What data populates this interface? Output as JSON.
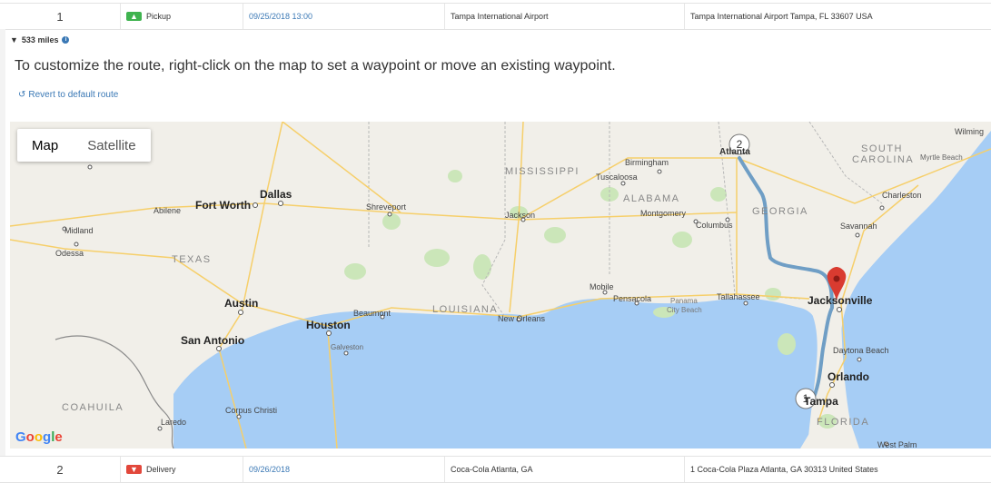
{
  "stop1": {
    "number": "1",
    "type": "Pickup",
    "date": "09/25/2018 13:00",
    "location": "Tampa International Airport",
    "address": "Tampa International Airport Tampa, FL 33607 USA"
  },
  "route": {
    "distance": "533 miles",
    "instructions": "To customize the route, right-click on the map to set a waypoint or move an existing waypoint.",
    "revert_label": "Revert to default route"
  },
  "map": {
    "type_map": "Map",
    "type_satellite": "Satellite",
    "logo": "Google",
    "marker1": "1",
    "marker2": "2",
    "labels": {
      "mississippi": "MISSISSIPPI",
      "alabama": "ALABAMA",
      "georgia": "GEORGIA",
      "south": "SOUTH",
      "carolina": "CAROLINA",
      "texas": "TEXAS",
      "louisiana": "LOUISIANA",
      "florida": "FLORIDA",
      "coahuila": "COAHUILA",
      "wilming": "Wilming",
      "myrtle": "Myrtle Beach",
      "atlanta": "Atlanta",
      "birmingham": "Birmingham",
      "tuscaloosa": "Tuscaloosa",
      "charleston": "Charleston",
      "savannah": "Savannah",
      "montgomery": "Montgomery",
      "columbus": "Columbus",
      "jackson": "Jackson",
      "shreveport": "Shreveport",
      "dallas": "Dallas",
      "fortworth": "Fort Worth",
      "abilene": "Abilene",
      "midland": "Midland",
      "odessa": "Odessa",
      "austin": "Austin",
      "houston": "Houston",
      "sanantonio": "San Antonio",
      "beaumont": "Beaumont",
      "galveston": "Galveston",
      "corpus": "Corpus Christi",
      "laredo": "Laredo",
      "neworleans": "New Orleans",
      "mobile": "Mobile",
      "pensacola": "Pensacola",
      "panama": "Panama",
      "panama2": "City Beach",
      "tallahassee": "Tallahassee",
      "jacksonville": "Jacksonville",
      "daytona": "Daytona Beach",
      "orlando": "Orlando",
      "tampa": "Tampa",
      "westpalm": "West Palm"
    },
    "colors": {
      "water": "#a6cdf5",
      "land": "#f1efe9",
      "route": "#6f9ec5",
      "marker": "#d93b30"
    }
  },
  "stop2": {
    "number": "2",
    "type": "Delivery",
    "date": "09/26/2018",
    "location": "Coca-Cola Atlanta, GA",
    "address": "1 Coca-Cola Plaza Atlanta, GA 30313 United States"
  }
}
